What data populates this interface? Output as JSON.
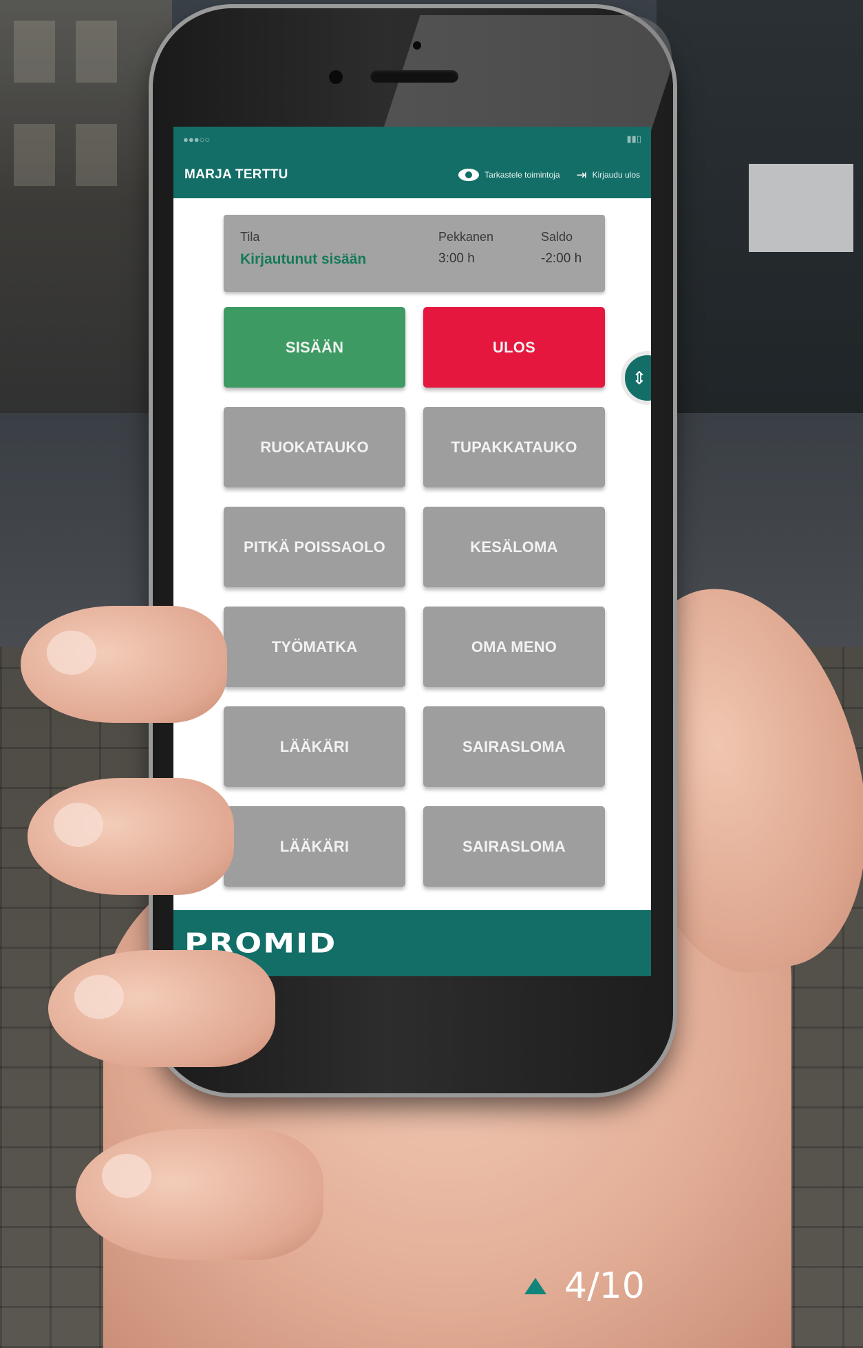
{
  "app": {
    "user_name": "MARJA TERTTU",
    "actions": {
      "visibility_label": "Tarkastele toimintoja",
      "logout_label": "Kirjaudu ulos"
    }
  },
  "status_card": {
    "state_label": "Tila",
    "state_value": "Kirjautunut sisään",
    "pekkanen_label": "Pekkanen",
    "pekkanen_value": "3:00 h",
    "saldo_label": "Saldo",
    "saldo_value": "-2:00 h"
  },
  "buttons": [
    {
      "label": "SISÄÄN",
      "color": "#3d9a63"
    },
    {
      "label": "ULOS",
      "color": "#e5173f"
    },
    {
      "label": "RUOKATAUKO"
    },
    {
      "label": "TUPAKKATAUKO"
    },
    {
      "label": "PITKÄ POISSAOLO"
    },
    {
      "label": "KESÄLOMA"
    },
    {
      "label": "TYÖMATKA"
    },
    {
      "label": "OMA MENO"
    },
    {
      "label": "LÄÄKÄRI"
    },
    {
      "label": "SAIRASLOMA"
    },
    {
      "label": "LÄÄKÄRI"
    },
    {
      "label": "SAIRASLOMA"
    }
  ],
  "footer": {
    "brand": "PROMID"
  },
  "pager": {
    "text": "4/10"
  },
  "colors": {
    "primary": "#136e67",
    "in": "#3d9a63",
    "out": "#e5173f",
    "button": "#9e9e9e"
  }
}
